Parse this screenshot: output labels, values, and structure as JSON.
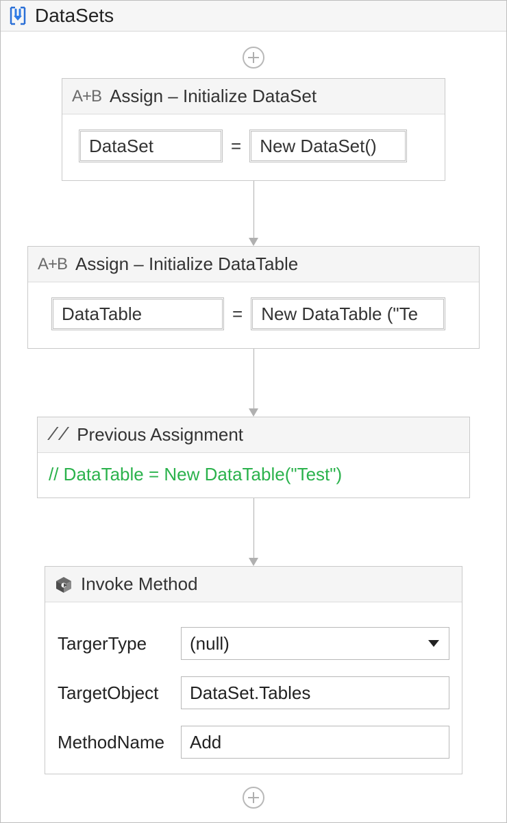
{
  "sequence": {
    "title": "DataSets"
  },
  "assign1": {
    "title": "Assign – Initialize DataSet",
    "left": "DataSet",
    "right": "New DataSet()"
  },
  "assign2": {
    "title": "Assign – Initialize DataTable",
    "left": "DataTable",
    "right": "New DataTable (\"Te"
  },
  "comment": {
    "title": "Previous Assignment",
    "text": "// DataTable = New DataTable(\"Test\")"
  },
  "invoke": {
    "title": "Invoke Method",
    "labels": {
      "targetType": "TargerType",
      "targetObject": "TargetObject",
      "methodName": "MethodName"
    },
    "values": {
      "targetType": "(null)",
      "targetObject": "DataSet.Tables",
      "methodName": "Add"
    }
  }
}
